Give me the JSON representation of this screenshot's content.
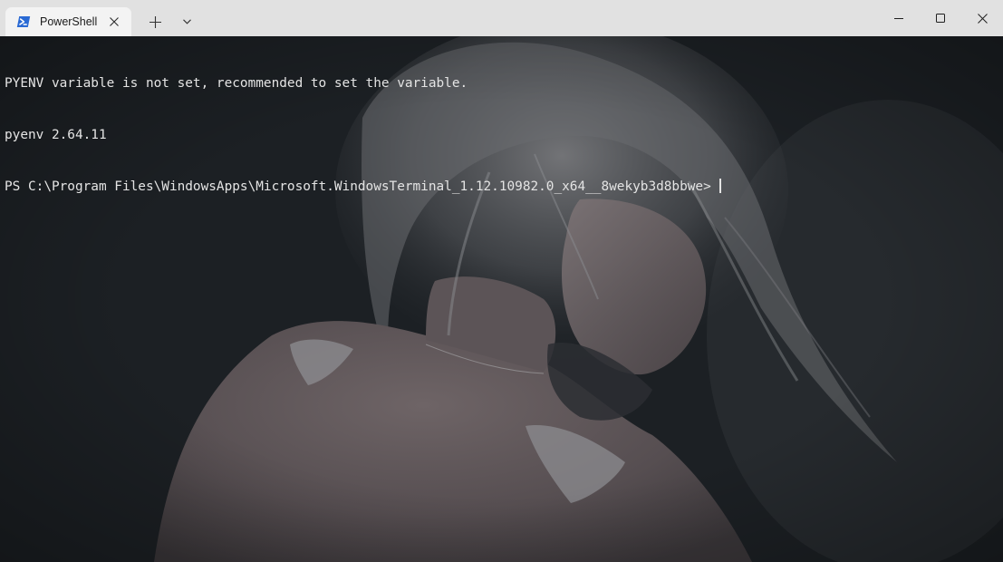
{
  "window": {
    "tab": {
      "title": "PowerShell",
      "icon": "powershell-icon"
    },
    "controls": {
      "new_tab_icon": "plus-icon",
      "dropdown_icon": "chevron-down-icon",
      "minimize_icon": "minimize-icon",
      "maximize_icon": "maximize-icon",
      "close_icon": "close-icon"
    },
    "colors": {
      "titlebar": "#e1e1e1",
      "tab_active": "#f3f3f3",
      "terminal_background": "#1b1e21",
      "terminal_foreground": "#e4e4e4",
      "powershell_icon": "#2a6ad4"
    }
  },
  "terminal": {
    "lines": [
      "PYENV variable is not set, recommended to set the variable.",
      "pyenv 2.64.11"
    ],
    "prompt": "PS C:\\Program Files\\WindowsApps\\Microsoft.WindowsTerminal_1.12.10982.0_x64__8wekyb3d8bbwe>",
    "background_image": "woman-with-braided-hair-painting"
  }
}
